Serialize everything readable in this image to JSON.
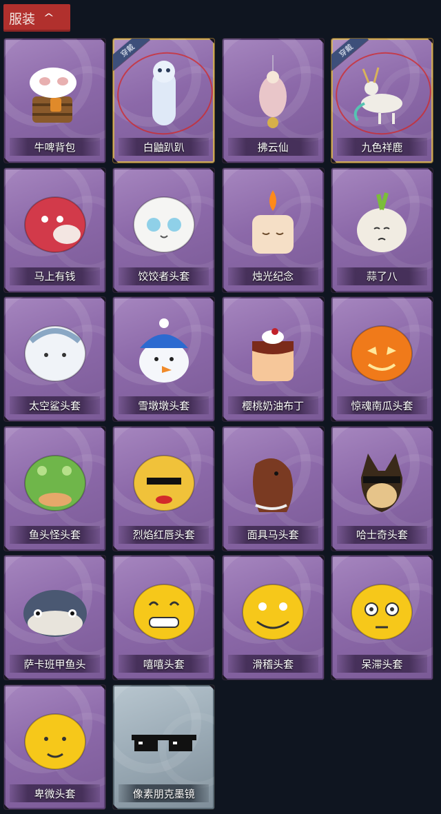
{
  "header": {
    "tab_label": "服装"
  },
  "equipped_badge": "穿戴",
  "items": [
    {
      "label": "牛啤背包",
      "icon": "cow-beer-backpack-icon",
      "equipped": false,
      "glass": false
    },
    {
      "label": "白鼬趴趴",
      "icon": "white-ferret-icon",
      "equipped": true,
      "glass": false
    },
    {
      "label": "拂云仙",
      "icon": "cloud-fairy-pendant-icon",
      "equipped": false,
      "glass": false
    },
    {
      "label": "九色祥鹿",
      "icon": "nine-color-deer-icon",
      "equipped": true,
      "glass": false
    },
    {
      "label": "马上有钱",
      "icon": "red-horse-mask-icon",
      "equipped": false,
      "glass": false
    },
    {
      "label": "饺饺者头套",
      "icon": "dumpling-mask-icon",
      "equipped": false,
      "glass": false
    },
    {
      "label": "烛光纪念",
      "icon": "candle-mask-icon",
      "equipped": false,
      "glass": false
    },
    {
      "label": "蒜了八",
      "icon": "garlic-mask-icon",
      "equipped": false,
      "glass": false
    },
    {
      "label": "太空鲨头套",
      "icon": "space-shark-mask-icon",
      "equipped": false,
      "glass": false
    },
    {
      "label": "雪墩墩头套",
      "icon": "snowman-mask-icon",
      "equipped": false,
      "glass": false
    },
    {
      "label": "樱桃奶油布丁",
      "icon": "cherry-pudding-mask-icon",
      "equipped": false,
      "glass": false
    },
    {
      "label": "惊魂南瓜头套",
      "icon": "pumpkin-mask-icon",
      "equipped": false,
      "glass": false
    },
    {
      "label": "鱼头怪头套",
      "icon": "fish-head-mask-icon",
      "equipped": false,
      "glass": false
    },
    {
      "label": "烈焰红唇头套",
      "icon": "red-lips-mask-icon",
      "equipped": false,
      "glass": false
    },
    {
      "label": "面具马头套",
      "icon": "horse-mask-icon",
      "equipped": false,
      "glass": false
    },
    {
      "label": "哈士奇头套",
      "icon": "husky-mask-icon",
      "equipped": false,
      "glass": false
    },
    {
      "label": "萨卡班甲鱼头",
      "icon": "sacabambaspis-mask-icon",
      "equipped": false,
      "glass": false
    },
    {
      "label": "嘻嘻头套",
      "icon": "grin-emoji-mask-icon",
      "equipped": false,
      "glass": false
    },
    {
      "label": "滑稽头套",
      "icon": "smirk-emoji-mask-icon",
      "equipped": false,
      "glass": false
    },
    {
      "label": "呆滞头套",
      "icon": "stunned-emoji-mask-icon",
      "equipped": false,
      "glass": false
    },
    {
      "label": "卑微头套",
      "icon": "humble-emoji-mask-icon",
      "equipped": false,
      "glass": false
    },
    {
      "label": "像素朋克墨镜",
      "icon": "pixel-sunglasses-icon",
      "equipped": false,
      "glass": true
    }
  ]
}
